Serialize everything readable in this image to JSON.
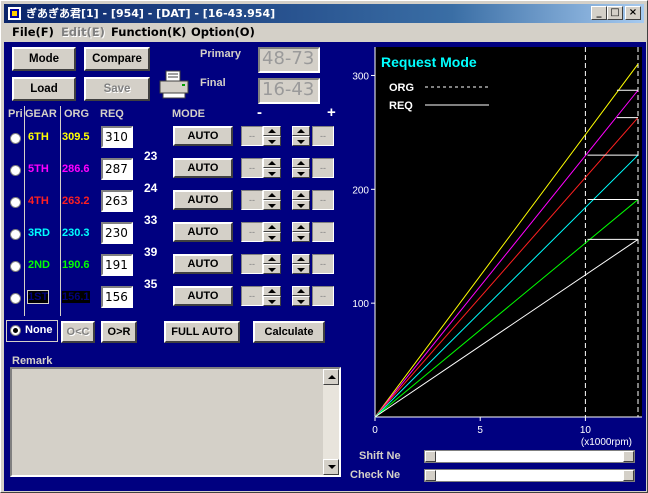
{
  "window": {
    "title": "ぎあぎあ君[1] - [954] - [DAT] - [16-43.954]"
  },
  "menu": [
    {
      "label": "File(F)",
      "enabled": true
    },
    {
      "label": "Edit(E)",
      "enabled": false
    },
    {
      "label": "Function(K)",
      "enabled": true
    },
    {
      "label": "Option(O)",
      "enabled": true
    }
  ],
  "buttons": {
    "mode": "Mode",
    "compare": "Compare",
    "load": "Load",
    "save": "Save",
    "oc": "O<C",
    "or": "O>R",
    "full_auto": "FULL AUTO",
    "calculate": "Calculate"
  },
  "primary": {
    "label": "Primary",
    "value": "48-73"
  },
  "final": {
    "label": "Final",
    "value": "16-43"
  },
  "headers": {
    "pri": "Pri",
    "gear": "GEAR",
    "org": "ORG",
    "req": "REQ",
    "mode": "MODE",
    "minus": "-",
    "plus": "+"
  },
  "gears": [
    {
      "name": "6TH",
      "org": "309.5",
      "req": "310",
      "color": "#ffff00",
      "auto": "AUTO"
    },
    {
      "name": "5TH",
      "org": "286.6",
      "req": "287",
      "color": "#ff00ff",
      "auto": "AUTO"
    },
    {
      "name": "4TH",
      "org": "263.2",
      "req": "263",
      "color": "#ff2020",
      "auto": "AUTO"
    },
    {
      "name": "3RD",
      "org": "230.3",
      "req": "230",
      "color": "#00ffff",
      "auto": "AUTO"
    },
    {
      "name": "2ND",
      "org": "190.6",
      "req": "191",
      "color": "#00ff00",
      "auto": "AUTO"
    },
    {
      "name": "1ST",
      "org": "156.1",
      "req": "156",
      "color": "#000080",
      "auto": "AUTO"
    }
  ],
  "diffs": [
    "23",
    "24",
    "33",
    "39",
    "35"
  ],
  "spin_placeholder": "--",
  "none_label": "None",
  "remark_label": "Remark",
  "chart_data": {
    "type": "line",
    "title": "Request Mode",
    "legend": [
      {
        "name": "ORG",
        "style": "dashed"
      },
      {
        "name": "REQ",
        "style": "solid"
      }
    ],
    "legend_position": "top-left",
    "xlim": [
      0,
      12.5
    ],
    "ylim": [
      0,
      325
    ],
    "xticks": [
      0,
      5,
      10
    ],
    "yticks": [
      100,
      200,
      300
    ],
    "xlabel": "(x1000rpm)",
    "vlines": [
      10,
      12.5
    ],
    "series": [
      {
        "color": "#ffff00",
        "start": [
          0,
          0
        ],
        "end": [
          12.5,
          310
        ]
      },
      {
        "color": "#ff00ff",
        "start": [
          0,
          0
        ],
        "end": [
          12.5,
          287
        ]
      },
      {
        "color": "#ff2020",
        "start": [
          0,
          0
        ],
        "end": [
          12.5,
          263
        ]
      },
      {
        "color": "#00ffff",
        "start": [
          0,
          0
        ],
        "end": [
          12.5,
          230
        ]
      },
      {
        "color": "#00ff00",
        "start": [
          0,
          0
        ],
        "end": [
          12.5,
          191
        ]
      },
      {
        "color": "#ffffff",
        "start": [
          0,
          0
        ],
        "end": [
          12.5,
          156
        ]
      }
    ],
    "shift_points": [
      {
        "x": 11.5,
        "y": 287
      },
      {
        "x": 11.5,
        "y": 263
      },
      {
        "x": 10.1,
        "y": 230
      },
      {
        "x": 10.1,
        "y": 191
      },
      {
        "x": 10.1,
        "y": 156
      }
    ],
    "grid": false
  },
  "shift_ne_label": "Shift Ne",
  "check_ne_label": "Check Ne",
  "colors": {
    "client_bg": "#000080",
    "chart_bg": "#000000",
    "title_color": "#00ffff"
  }
}
